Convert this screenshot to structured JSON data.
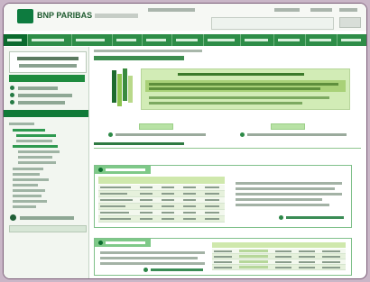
{
  "brand": {
    "logo_text": "BNP PARIBAS"
  },
  "colors": {
    "brand_green": "#0d7b3f",
    "nav_green": "#2e8d48",
    "panel_green": "#7ec988",
    "hero_green": "#d2ecb6"
  },
  "icons": [
    "bnp-logo-icon",
    "search-icon",
    "book-icon",
    "panel-dot-icon",
    "link-arrow-icon"
  ],
  "search": {
    "placeholder": ""
  },
  "nav": {
    "items": [
      "",
      "",
      "",
      "",
      "",
      "",
      "",
      "",
      "",
      "",
      "",
      ""
    ]
  },
  "sidebar": {
    "promo_title": "",
    "promo_subtitle": "",
    "button": "",
    "tree_header": ""
  },
  "main": {
    "breadcrumb": "",
    "page_title": "",
    "hero_title": "",
    "hero_text": "",
    "cta_left_title": "",
    "cta_left_link": "",
    "cta_right_title": "",
    "cta_right_link": "",
    "section_title": "",
    "panel1_title": "",
    "panel1_link": "",
    "panel2_title": "",
    "panel2_link": ""
  }
}
